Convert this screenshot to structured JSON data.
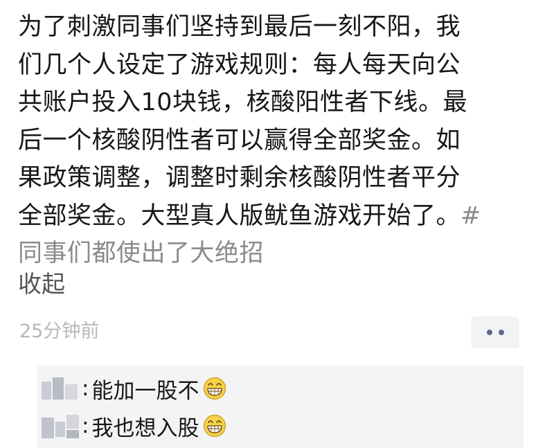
{
  "post": {
    "lines": [
      "为了刺激同事们坚持到最后一刻不阳，我",
      "们几个人设定了游戏规则：每人每天向公",
      "共账户投入10块钱，核酸阳性者下线。最",
      "后一个核酸阴性者可以赢得全部奖金。如",
      "果政策调整，调整时剩余核酸阴性者平分",
      "全部奖金。大型真人版鱿鱼游戏开始了。"
    ],
    "hashtag_part1": "#",
    "hashtag_part2": "同事们都使出了大绝招",
    "collapse_label": "收起"
  },
  "meta": {
    "timestamp": "25分钟前",
    "more_icon": "more-dots-icon"
  },
  "comments": [
    {
      "separator": ":",
      "text": "能加一股不",
      "emoji": "grin-emoji"
    },
    {
      "separator": ":",
      "text": "我也想入股",
      "emoji": "grin-emoji"
    }
  ],
  "colors": {
    "text": "#161616",
    "hashtag": "#8a8a8a",
    "timestamp": "#b8b8b8",
    "comment_bg": "#f4f4f6",
    "more_dots": "#5b6a8a",
    "emoji_face": "#f5d24a"
  }
}
